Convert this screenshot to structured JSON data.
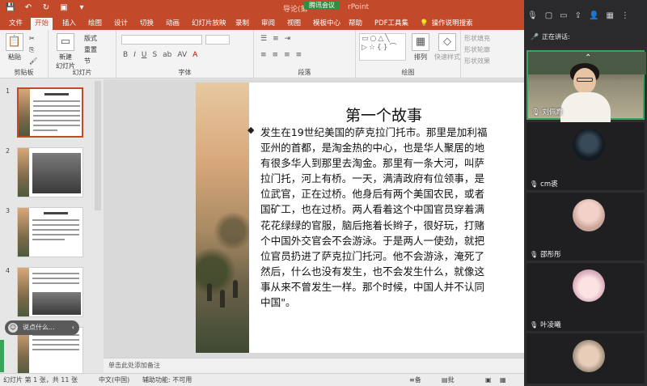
{
  "titlebar": {
    "doc_title": "导论(第",
    "doc_title_tail": "rPoint",
    "meeting_pill": "腾讯会议"
  },
  "tabs": [
    {
      "label": "文件"
    },
    {
      "label": "开始"
    },
    {
      "label": "插入"
    },
    {
      "label": "绘图"
    },
    {
      "label": "设计"
    },
    {
      "label": "切换"
    },
    {
      "label": "动画"
    },
    {
      "label": "幻灯片放映"
    },
    {
      "label": "录制"
    },
    {
      "label": "审阅"
    },
    {
      "label": "视图"
    },
    {
      "label": "模板中心"
    },
    {
      "label": "帮助"
    },
    {
      "label": "PDF工具集"
    },
    {
      "label": "操作说明搜索"
    }
  ],
  "ribbon": {
    "paste": "粘贴",
    "new_slide_1": "新建",
    "new_slide_2": "幻灯片",
    "layout": "版式",
    "reset": "重置",
    "section": "节",
    "arrange": "排列",
    "quick_styles": "快速样式",
    "shape_fill": "形状填充",
    "shape_outline": "形状轮廓",
    "shape_effect": "形状效果",
    "groups": {
      "clipboard": "剪贴板",
      "slides": "幻灯片",
      "font": "字体",
      "paragraph": "段落",
      "drawing": "绘图"
    }
  },
  "thumbnails": [
    {
      "num": "1",
      "title": "第一个故事",
      "selected": true
    },
    {
      "num": "2",
      "title": ""
    },
    {
      "num": "3",
      "title": "第二个故事"
    },
    {
      "num": "4",
      "title": ""
    },
    {
      "num": "5",
      "title": ""
    }
  ],
  "chat_pill": "说点什么...",
  "slide": {
    "title": "第一个故事",
    "body_lines": [
      "发生在19世纪美国的萨克拉门托市。那里是加利福",
      "亚州的首都，是淘金热的中心，也是华人聚居的地",
      "有很多华人到那里去淘金。那里有一条大河，叫萨",
      "拉门托，河上有桥。一天，满清政府有位领事，是",
      "位武官，正在过桥。他身后有两个美国农民，或者",
      "国矿工，也在过桥。两人看着这个中国官员穿着满",
      "花花绿绿的官服，脑后拖着长辫子，很好玩，打赌",
      "个中国外交官会不会游泳。于是两人一使劲，就把",
      "位官员扔进了萨克拉门托河。他不会游泳，淹死了",
      "然后，什么也没有发生，也不会发生什么，就像这",
      "事从来不曾发生一样。那个时候，中国人并不认同",
      "中国\"。"
    ]
  },
  "notes_placeholder": "单击此处添加备注",
  "status": {
    "slide_count": "幻灯片 第 1 张，共 11 张",
    "language": "中文(中国)",
    "accessibility": "辅助功能: 不可用",
    "notes": "备注",
    "comments": "批注"
  },
  "meeting": {
    "speaking_label": "正在讲话:",
    "participants": [
      {
        "name": "刘佩霞",
        "type": "camera",
        "mic_on": true
      },
      {
        "name": "cm裘",
        "type": "avatar"
      },
      {
        "name": "邵彤彤",
        "type": "avatar"
      },
      {
        "name": "叶凌曦",
        "type": "avatar"
      },
      {
        "name": "",
        "type": "avatar"
      }
    ]
  },
  "colors": {
    "ppt_accent": "#c24a2b",
    "meeting_green": "#3aa55a"
  }
}
